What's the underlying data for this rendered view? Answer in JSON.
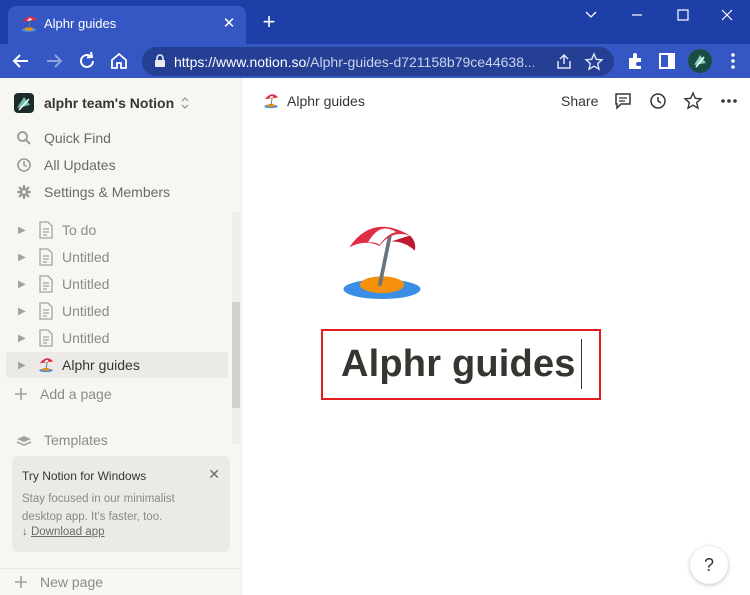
{
  "browser": {
    "tab_title": "Alphr guides",
    "tab_close": "✕",
    "new_tab": "+",
    "url_host": "https://www.notion.so",
    "url_path": "/Alphr-guides-d721158b79ce44638..."
  },
  "sidebar": {
    "workspace_name": "alphr team's Notion",
    "menu": [
      {
        "label": "Quick Find",
        "icon": "search-icon"
      },
      {
        "label": "All Updates",
        "icon": "clock-icon"
      },
      {
        "label": "Settings & Members",
        "icon": "gear-icon"
      }
    ],
    "pages": [
      {
        "label": "To do"
      },
      {
        "label": "Untitled"
      },
      {
        "label": "Untitled"
      },
      {
        "label": "Untitled"
      },
      {
        "label": "Untitled"
      },
      {
        "label": "Alphr guides"
      }
    ],
    "add_page": "Add a page",
    "templates": "Templates",
    "promo": {
      "title": "Try Notion for Windows",
      "text": "Stay focused in our minimalist desktop app. It's faster, too.",
      "link": "Download app",
      "close": "✕"
    },
    "new_page": "New page"
  },
  "main": {
    "breadcrumb": "Alphr guides",
    "share": "Share",
    "page_title": "Alphr guides",
    "help": "?"
  },
  "colors": {
    "chrome_frame": "#1f3fa8",
    "highlight_border": "#e11c1c",
    "sidebar_bg": "#f7f6f3"
  }
}
